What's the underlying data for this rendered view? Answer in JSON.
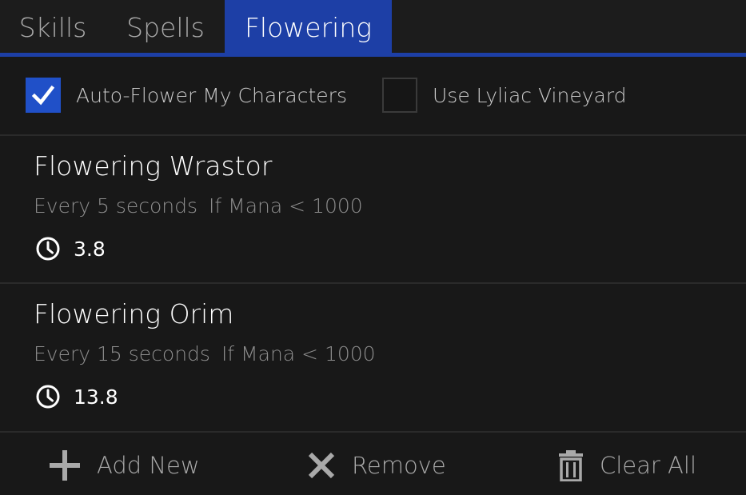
{
  "tabs": [
    {
      "label": "Skills",
      "active": false
    },
    {
      "label": "Spells",
      "active": false
    },
    {
      "label": "Flowering",
      "active": true
    }
  ],
  "options": {
    "auto_flower": {
      "label": "Auto-Flower My Characters",
      "checked": true
    },
    "lyliac": {
      "label": "Use Lyliac Vineyard",
      "checked": false
    }
  },
  "items": [
    {
      "title": "Flowering Wrastor",
      "interval": "Every 5 seconds",
      "condition": "If Mana < 1000",
      "timer": "3.8",
      "icon": "clock-icon"
    },
    {
      "title": "Flowering Orim",
      "interval": "Every 15 seconds",
      "condition": "If Mana < 1000",
      "timer": "13.8",
      "icon": "clock-icon"
    }
  ],
  "actions": {
    "add": {
      "label": "Add New",
      "icon": "plus-icon"
    },
    "remove": {
      "label": "Remove",
      "icon": "x-icon"
    },
    "clear": {
      "label": "Clear All",
      "icon": "trash-icon"
    }
  },
  "colors": {
    "accent": "#1d3fa6",
    "checkbox_checked": "#2050c8",
    "background": "#181818",
    "muted_text": "#8d8d8d"
  }
}
